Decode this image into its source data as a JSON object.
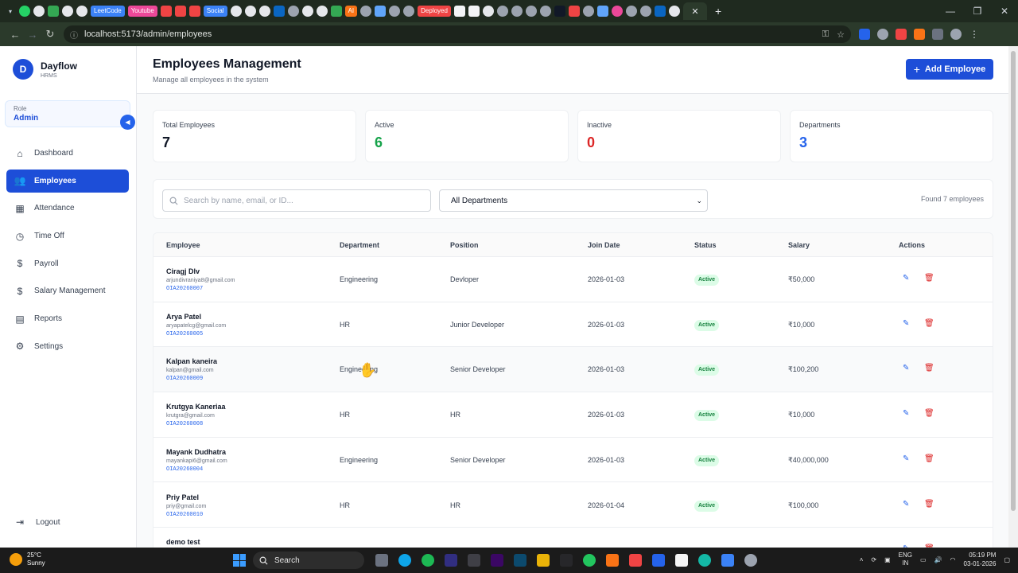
{
  "browser": {
    "tabs": [
      {
        "label": "LeetCode",
        "color": "#3b82f6"
      },
      {
        "label": "Youtube",
        "color": "#ec4899"
      },
      {
        "label": "Social",
        "color": "#3b82f6"
      },
      {
        "label": "AI",
        "color": "#f97316"
      },
      {
        "label": "Deployed",
        "color": "#ef4444"
      }
    ],
    "url": "localhost:5173/admin/employees"
  },
  "sidebar": {
    "brand_initial": "D",
    "brand_name": "Dayflow",
    "brand_sub": "HRMS",
    "role_label": "Role",
    "role_value": "Admin",
    "items": [
      {
        "label": "Dashboard",
        "icon": "home-icon"
      },
      {
        "label": "Employees",
        "icon": "users-icon",
        "active": true
      },
      {
        "label": "Attendance",
        "icon": "calendar-icon"
      },
      {
        "label": "Time Off",
        "icon": "clock-icon"
      },
      {
        "label": "Payroll",
        "icon": "dollar-icon"
      },
      {
        "label": "Salary Management",
        "icon": "dollar-icon"
      },
      {
        "label": "Reports",
        "icon": "document-icon"
      },
      {
        "label": "Settings",
        "icon": "gear-icon"
      }
    ],
    "logout_label": "Logout"
  },
  "header": {
    "title": "Employees Management",
    "subtitle": "Manage all employees in the system",
    "add_button": "Add Employee"
  },
  "stats": [
    {
      "label": "Total Employees",
      "value": "7",
      "color": "#111827"
    },
    {
      "label": "Active",
      "value": "6",
      "color": "#16a34a"
    },
    {
      "label": "Inactive",
      "value": "0",
      "color": "#dc2626"
    },
    {
      "label": "Departments",
      "value": "3",
      "color": "#2563eb"
    }
  ],
  "filters": {
    "search_placeholder": "Search by name, email, or ID...",
    "department_selected": "All Departments",
    "found_text": "Found 7 employees"
  },
  "table": {
    "headers": [
      "Employee",
      "Department",
      "Position",
      "Join Date",
      "Status",
      "Salary",
      "Actions"
    ],
    "rows": [
      {
        "name": "Ciragj Dlv",
        "email": "arjundivraniya8@gmail.com",
        "id": "OIA20260007",
        "department": "Engineering",
        "position": "Devloper",
        "join_date": "2026-01-03",
        "status": "Active",
        "salary": "₹50,000"
      },
      {
        "name": "Arya Patel",
        "email": "aryapatelcg@gmail.com",
        "id": "OIA20260005",
        "department": "HR",
        "position": "Junior Developer",
        "join_date": "2026-01-03",
        "status": "Active",
        "salary": "₹10,000"
      },
      {
        "name": "Kalpan kaneira",
        "email": "kalpan@gmail.com",
        "id": "OIA20260009",
        "department": "Engineering",
        "position": "Senior Developer",
        "join_date": "2026-01-03",
        "status": "Active",
        "salary": "₹100,200"
      },
      {
        "name": "Krutgya Kaneriaa",
        "email": "krutgra@gmail.com",
        "id": "OIA20260008",
        "department": "HR",
        "position": "HR",
        "join_date": "2026-01-03",
        "status": "Active",
        "salary": "₹10,000"
      },
      {
        "name": "Mayank Dudhatra",
        "email": "mayankapi6@gmail.com",
        "id": "OIA20260004",
        "department": "Engineering",
        "position": "Senior Developer",
        "join_date": "2026-01-03",
        "status": "Active",
        "salary": "₹40,000,000"
      },
      {
        "name": "Priy Patel",
        "email": "priy@gmail.com",
        "id": "OIA20260010",
        "department": "HR",
        "position": "HR",
        "join_date": "2026-01-04",
        "status": "Active",
        "salary": "₹100,000"
      },
      {
        "name": "demo test",
        "email": "",
        "id": "",
        "department": "",
        "position": "",
        "join_date": "",
        "status": "",
        "salary": ""
      }
    ]
  },
  "taskbar": {
    "temperature": "25°C",
    "weather": "Sunny",
    "search_label": "Search",
    "lang_top": "ENG",
    "lang_bottom": "IN",
    "time": "05:19 PM",
    "date": "03-01-2026"
  }
}
